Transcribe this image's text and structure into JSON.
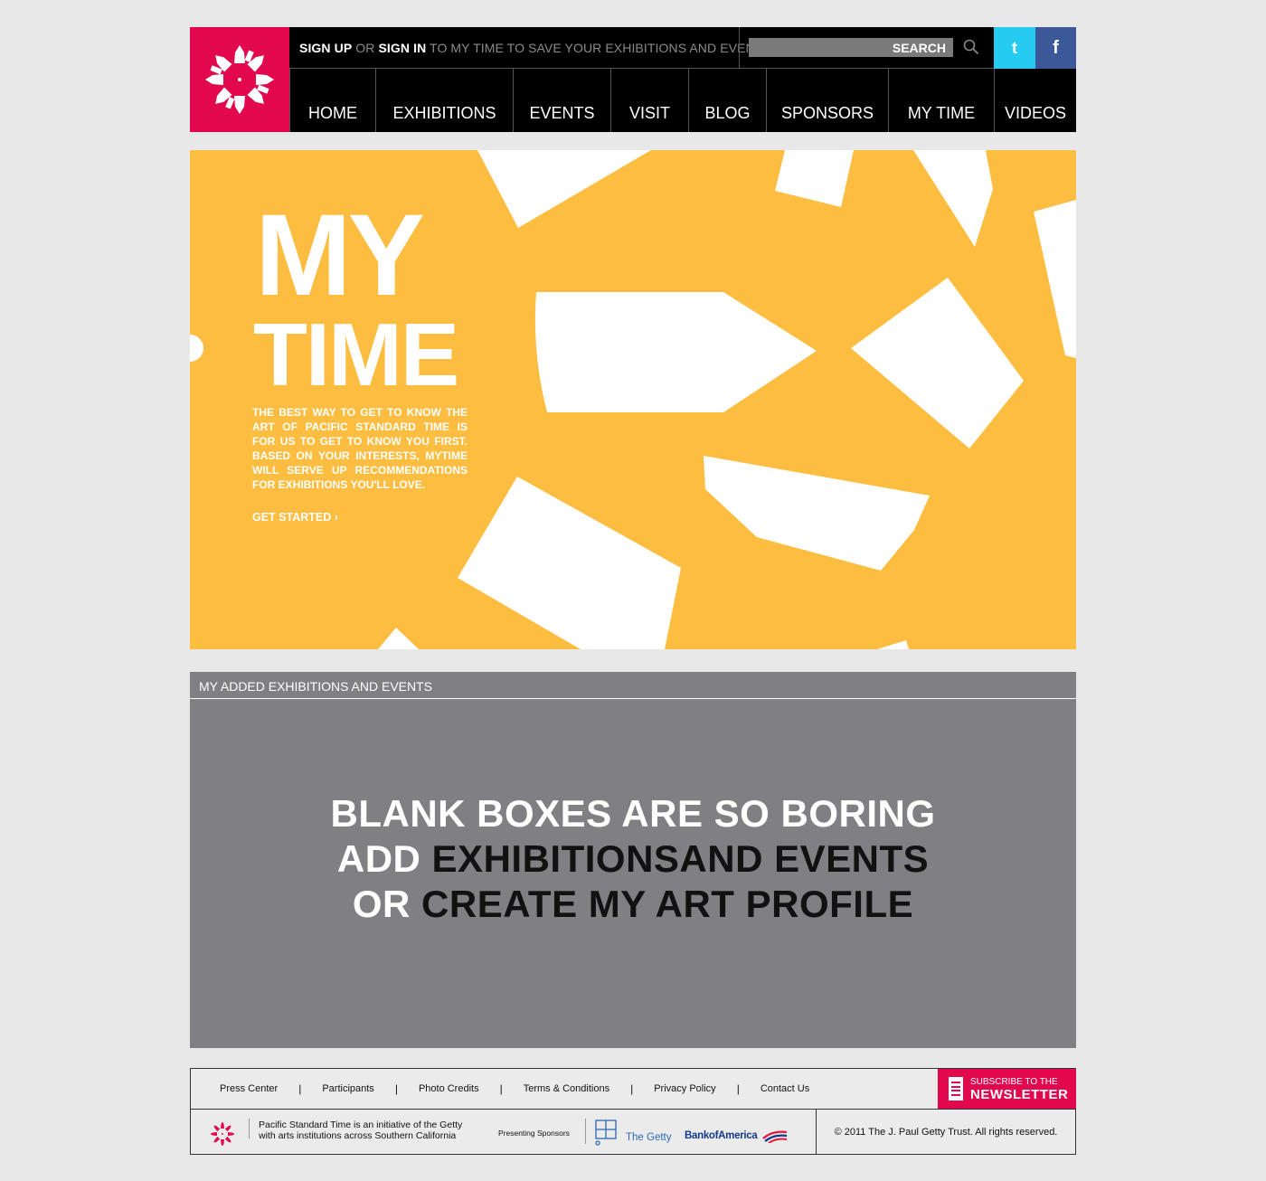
{
  "colors": {
    "brand_pink": "#e1084e",
    "hero_yellow": "#fdbd41",
    "section_gray": "#808084",
    "twitter_blue": "#25cbf0",
    "facebook_blue": "#3b5998"
  },
  "header": {
    "logo_icon": "sunburst-logo-icon",
    "signup": {
      "sign_up": "SIGN UP",
      "or": "OR",
      "sign_in": "SIGN IN",
      "rest": "TO MY TIME TO SAVE YOUR EXHIBITIONS AND EVENTS"
    },
    "search": {
      "placeholder": "SEARCH",
      "icon": "search-icon"
    },
    "social": {
      "twitter": "t",
      "facebook": "f"
    },
    "nav": [
      "HOME",
      "EXHIBITIONS",
      "EVENTS",
      "VISIT",
      "BLOG",
      "SPONSORS",
      "MY TIME",
      "VIDEOS"
    ]
  },
  "hero": {
    "title_line1": "MY",
    "title_line2": "TIME",
    "description": "THE BEST WAY TO GET TO KNOW THE ART OF PACIFIC STANDARD TIME IS FOR US TO GET TO KNOW YOU FIRST. BASED ON YOUR INTERESTS, MYTIME WILL SERVE UP RECOMMENDATIONS FOR EXHIBITIONS YOU'LL LOVE.",
    "cta": "GET STARTED ›"
  },
  "added": {
    "heading": "MY ADDED EXHIBITIONS AND EVENTS",
    "line1": "BLANK BOXES ARE SO BORING",
    "line2_prefix": "ADD ",
    "line2_link": "EXHIBITIONSAND EVENTS",
    "line3_prefix": "OR ",
    "line3_link": "CREATE MY ART PROFILE"
  },
  "footer": {
    "links": [
      "Press Center",
      "Participants",
      "Photo Credits",
      "Terms & Conditions",
      "Privacy Policy",
      "Contact Us"
    ],
    "separator": "|",
    "subscribe_small": "SUBSCRIBE TO THE",
    "subscribe_big": "NEWSLETTER",
    "initiative_line1": "Pacific Standard Time is an initiative of the Getty",
    "initiative_line2": "with arts institutions across Southern California",
    "presenting": "Presenting Sponsors",
    "getty": "The Getty",
    "boa": "BankofAmerica",
    "copyright": "© 2011 The J. Paul Getty Trust. All rights reserved."
  }
}
